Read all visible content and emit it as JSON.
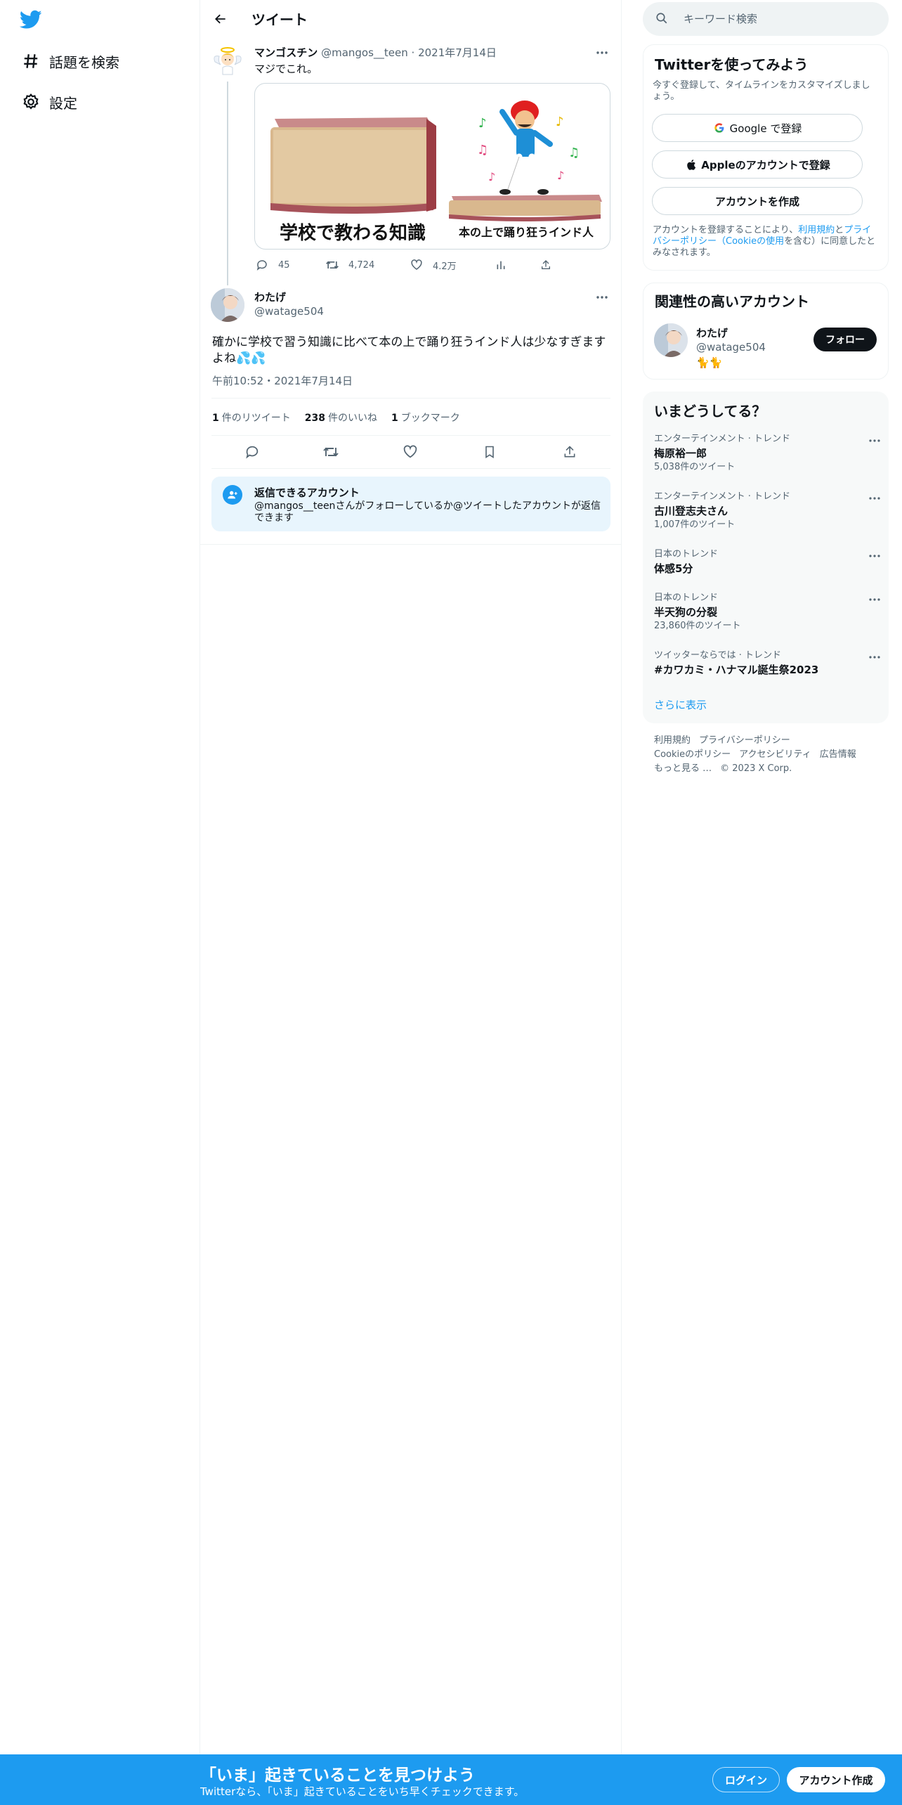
{
  "nav": {
    "items": [
      {
        "label": "話題を検索",
        "icon": "hashtag-icon"
      },
      {
        "label": "設定",
        "icon": "gear-icon"
      }
    ]
  },
  "header": {
    "title": "ツイート"
  },
  "original_tweet": {
    "name": "マンゴスチン",
    "handle": "@mangos__teen",
    "date": "· 2021年7月14日",
    "text": "マジでこれ。",
    "media": {
      "caption_left": "学校で教わる知識",
      "caption_right": "本の上で踊り狂うインド人"
    },
    "replies": "45",
    "retweets": "4,724",
    "likes": "4.2万"
  },
  "main_tweet": {
    "name": "わたげ",
    "handle": "@watage504",
    "text": "確かに学校で習う知識に比べて本の上で踊り狂うインド人は少なすぎますよね💦💦",
    "timestamp": "午前10:52・2021年7月14日",
    "stats": {
      "retweets_count": "1",
      "retweets_label": "件のリツイート",
      "likes_count": "238",
      "likes_label": "件のいいね",
      "bookmarks_count": "1",
      "bookmarks_label": "ブックマーク"
    }
  },
  "reply_restriction": {
    "title": "返信できるアカウント",
    "description": "@mangos__teenさんがフォローしているか@ツイートしたアカウントが返信できます"
  },
  "search": {
    "placeholder": "キーワード検索"
  },
  "join_card": {
    "title": "Twitterを使ってみよう",
    "subtitle": "今すぐ登録して、タイムラインをカスタマイズしましょう。",
    "google_button": "Google で登録",
    "apple_button": "Appleのアカウントで登録",
    "create_button": "アカウントを作成",
    "terms_prefix": "アカウントを登録することにより、",
    "terms_link1": "利用規約",
    "terms_and": "と",
    "terms_link2": "プライバシーポリシー（Cookieの使用",
    "terms_suffix": "を含む）に同意したとみなされます。"
  },
  "related": {
    "title": "関連性の高いアカウント",
    "name": "わたげ",
    "handle": "@watage504",
    "bio": "🐈🐈",
    "follow_button": "フォロー"
  },
  "trends": {
    "title": "いまどうしてる？",
    "items": [
      {
        "context": "エンターテインメント · トレンド",
        "name": "梅原裕一郎",
        "count": "5,038件のツイート"
      },
      {
        "context": "エンターテインメント · トレンド",
        "name": "古川登志夫さん",
        "count": "1,007件のツイート"
      },
      {
        "context": "日本のトレンド",
        "name": "体感5分",
        "count": ""
      },
      {
        "context": "日本のトレンド",
        "name": "半天狗の分裂",
        "count": "23,860件のツイート"
      },
      {
        "context": "ツイッターならでは · トレンド",
        "name": "#カワカミ・ハナマル誕生祭2023",
        "count": ""
      }
    ],
    "show_more": "さらに表示"
  },
  "footer": {
    "links": [
      "利用規約",
      "プライバシーポリシー",
      "Cookieのポリシー",
      "アクセシビリティ",
      "広告情報",
      "もっと見る …",
      "© 2023 X Corp."
    ]
  },
  "bottom_bar": {
    "title": "「いま」起きていることを見つけよう",
    "subtitle": "Twitterなら、「いま」起きていることをいち早くチェックできます。",
    "login": "ログイン",
    "signup": "アカウント作成"
  },
  "colors": {
    "brand": "#1d9bf0",
    "text": "#0f1419",
    "secondary": "#536471"
  }
}
